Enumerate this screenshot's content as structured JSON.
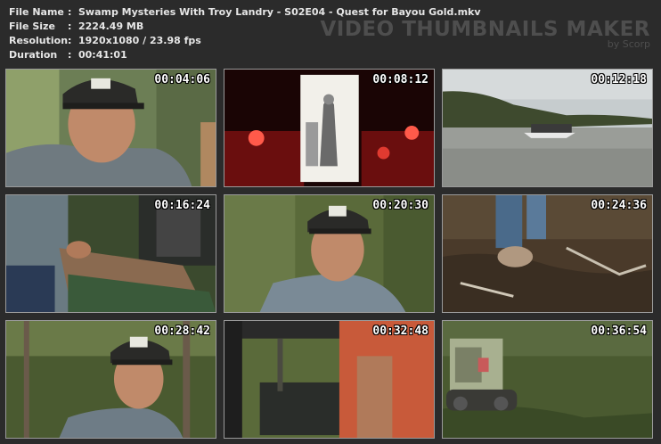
{
  "file_info": {
    "name_label": "File Name",
    "name_value": "Swamp Mysteries With Troy Landry - S02E04 - Quest for Bayou Gold.mkv",
    "size_label": "File Size",
    "size_value": "2224.49 MB",
    "resolution_label": "Resolution",
    "resolution_value": "1920x1080 / 23.98 fps",
    "duration_label": "Duration",
    "duration_value": "00:41:01",
    "colon": ":"
  },
  "brand": {
    "title": "VIDEO THUMBNAILS MAKER",
    "byline": "by Scorp"
  },
  "thumbnails": [
    {
      "time": "00:04:06",
      "scene": "man-in-cap-portrait"
    },
    {
      "time": "00:08:12",
      "scene": "candle-sketch-illustration"
    },
    {
      "time": "00:12:18",
      "scene": "airboat-on-river"
    },
    {
      "time": "00:16:24",
      "scene": "handling-wooden-planks"
    },
    {
      "time": "00:20:30",
      "scene": "man-in-cap-speaking"
    },
    {
      "time": "00:24:36",
      "scene": "boots-in-muddy-ground"
    },
    {
      "time": "00:28:42",
      "scene": "man-in-cap-woods"
    },
    {
      "time": "00:32:48",
      "scene": "vehicle-in-forest"
    },
    {
      "time": "00:36:54",
      "scene": "tracked-vehicle-in-brush"
    }
  ]
}
